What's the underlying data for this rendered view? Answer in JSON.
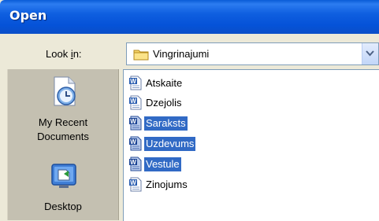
{
  "window": {
    "title": "Open"
  },
  "lookin": {
    "label_pre": "Look ",
    "label_key": "i",
    "label_post": "n:",
    "value": "Vingrinajumi"
  },
  "places": [
    {
      "line1": "My Recent",
      "line2": "Documents",
      "icon": "recent-documents-icon"
    },
    {
      "line1": "Desktop",
      "icon": "desktop-icon"
    }
  ],
  "files": [
    {
      "name": "Atskaite",
      "selected": false,
      "icon": "word-document-icon"
    },
    {
      "name": "Dzejolis",
      "selected": false,
      "icon": "word-document-icon"
    },
    {
      "name": "Saraksts",
      "selected": true,
      "icon": "word-document-icon"
    },
    {
      "name": "Uzdevums",
      "selected": true,
      "icon": "word-document-icon"
    },
    {
      "name": "Vestule",
      "selected": true,
      "icon": "word-document-icon"
    },
    {
      "name": "Zinojums",
      "selected": false,
      "icon": "word-document-icon"
    }
  ],
  "colors": {
    "titlebar": "#0552d8",
    "dialog_bg": "#ece9d8",
    "places_bg": "#c4c0b1",
    "selection": "#316ac5"
  }
}
